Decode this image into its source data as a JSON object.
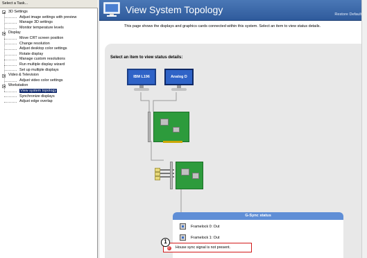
{
  "left_pane": {
    "header": "Select a Task...",
    "tree": [
      {
        "label": "3D Settings",
        "type": "cat"
      },
      {
        "label": "Adjust image settings with preview",
        "type": "leaf"
      },
      {
        "label": "Manage 3D settings",
        "type": "leaf"
      },
      {
        "label": "Monitor temperature levels",
        "type": "leaf"
      },
      {
        "label": "Display",
        "type": "cat"
      },
      {
        "label": "Move CRT screen position",
        "type": "leaf"
      },
      {
        "label": "Change resolution",
        "type": "leaf"
      },
      {
        "label": "Adjust desktop color settings",
        "type": "leaf"
      },
      {
        "label": "Rotate display",
        "type": "leaf"
      },
      {
        "label": "Manage custom resolutions",
        "type": "leaf"
      },
      {
        "label": "Run multiple display wizard",
        "type": "leaf"
      },
      {
        "label": "Set up multiple displays",
        "type": "leaf"
      },
      {
        "label": "Video & Television",
        "type": "cat"
      },
      {
        "label": "Adjust video color settings",
        "type": "leaf"
      },
      {
        "label": "Workstation",
        "type": "cat"
      },
      {
        "label": "View system topology",
        "type": "leaf",
        "selected": true
      },
      {
        "label": "Synchronize displays",
        "type": "leaf"
      },
      {
        "label": "Adjust edge overlap",
        "type": "leaf"
      }
    ]
  },
  "header": {
    "title": "View System Topology",
    "restore_defaults": "Restore Defaults"
  },
  "description": "This page shows the displays and graphics cards connected within this system. Select an item to view status details.",
  "topology": {
    "prompt": "Select an item to view status details:",
    "monitors": [
      "IBM L196",
      "Analog D"
    ]
  },
  "gsync": {
    "title": "G-Sync status",
    "framelock0": "Framelock 0: Out",
    "framelock1": "Framelock 1: Out",
    "house_sync": "House sync signal is not present.",
    "callout_number": "1"
  },
  "colors": {
    "banner": "#3a67a8",
    "panel_bg": "#e8e8e8",
    "card_green": "#2d9b3c",
    "gsync_header": "#5f8ed6",
    "warning_border": "#d21919",
    "selection": "#0a246a"
  }
}
